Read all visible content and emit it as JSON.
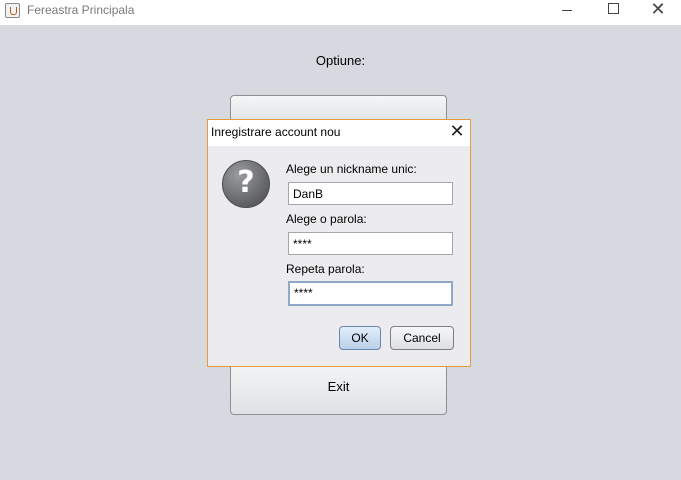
{
  "window": {
    "title": "Fereastra Principala",
    "icon": "java-cup-icon"
  },
  "main": {
    "option_label": "Optiune:",
    "top_button_label": "",
    "exit_button_label": "Exit"
  },
  "dialog": {
    "title": "Inregistrare account nou",
    "icon": "question-icon",
    "nickname_label": "Alege un nickname unic:",
    "nickname_value": "DanB",
    "password_label": "Alege o parola:",
    "password_value": "****",
    "repeat_label": "Repeta parola:",
    "repeat_value": "****",
    "ok_label": "OK",
    "cancel_label": "Cancel"
  },
  "colors": {
    "dialog_border": "#e59b3a",
    "background": "#d6d9df",
    "focus_border": "#8fa8c8"
  }
}
